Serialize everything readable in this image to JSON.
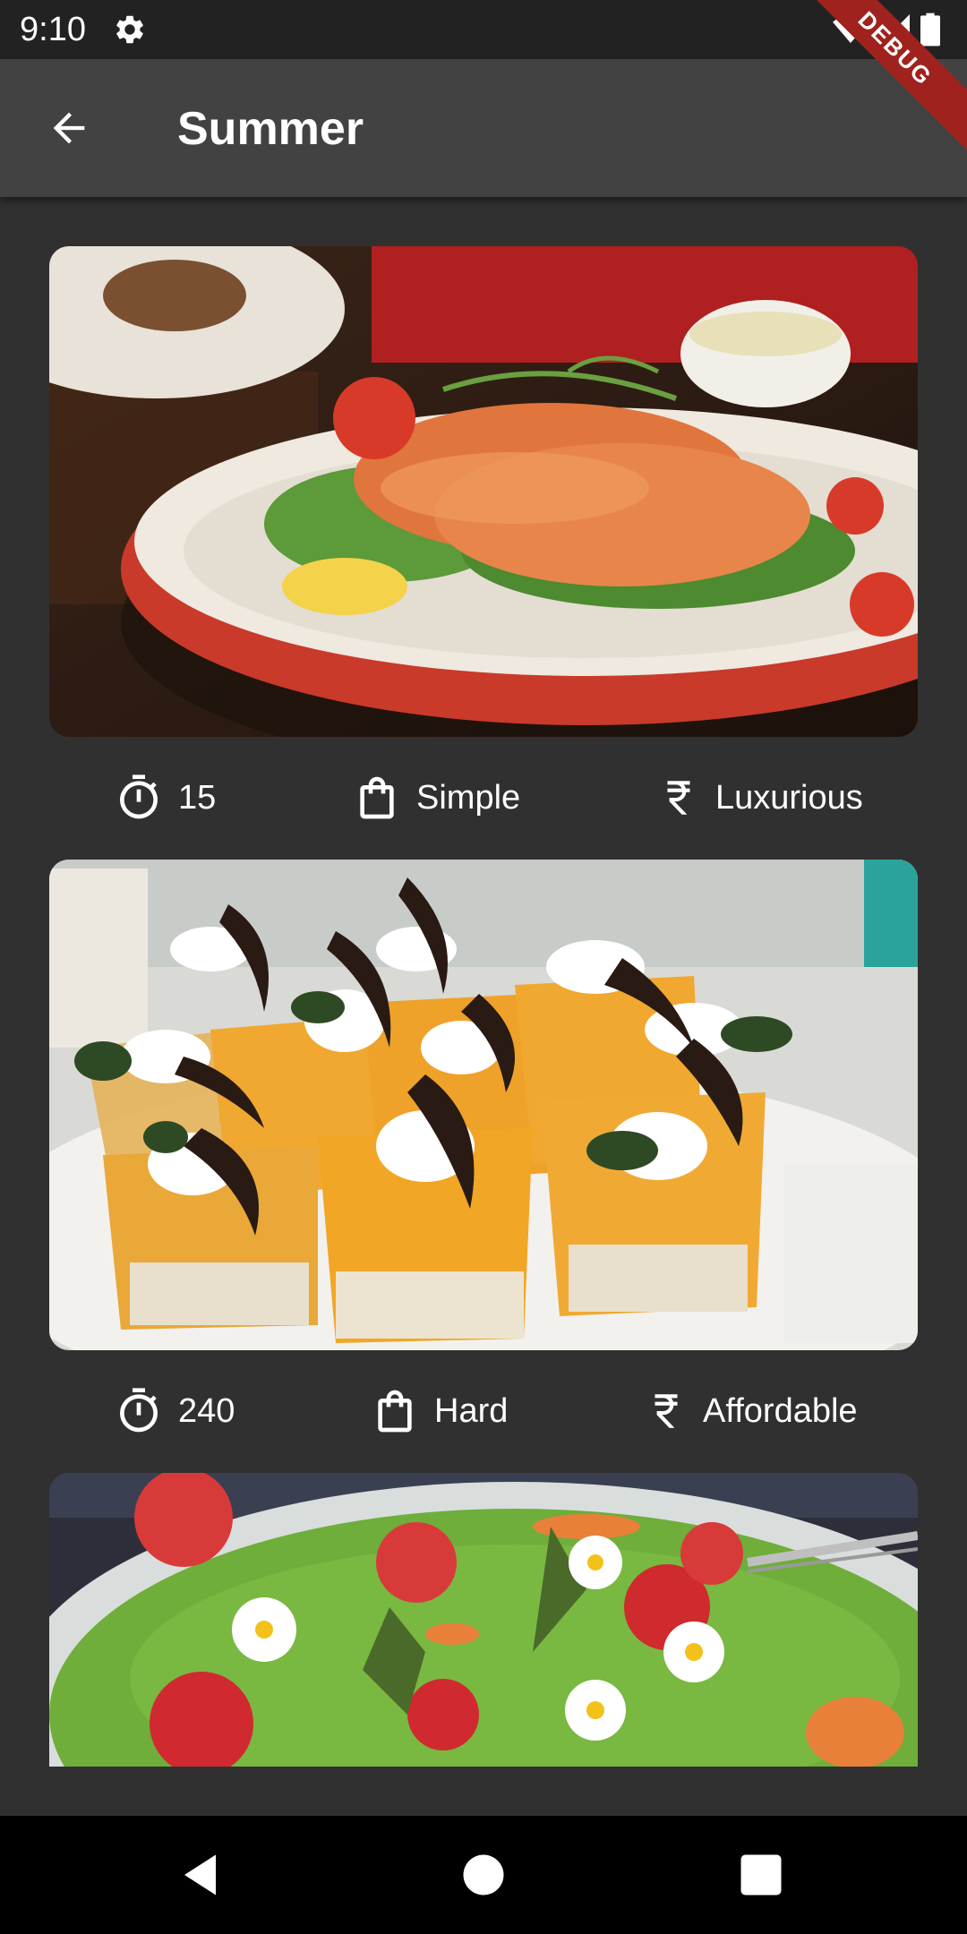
{
  "status_bar": {
    "time": "9:10",
    "icons": [
      "gear-icon",
      "wifi-icon",
      "signal-icon",
      "battery-icon"
    ]
  },
  "debug_banner": "DEBUG",
  "app_bar": {
    "back_icon": "arrow-back-icon",
    "title": "Summer"
  },
  "meals": [
    {
      "image": "smoked salmon salad plate",
      "duration": "15",
      "complexity": "Simple",
      "affordability": "Luxurious"
    },
    {
      "image": "mango mousse dessert cups",
      "duration": "240",
      "complexity": "Hard",
      "affordability": "Affordable"
    },
    {
      "image": "asparagus strawberry salad bowl",
      "duration": "",
      "complexity": "",
      "affordability": ""
    }
  ],
  "meta_icons": {
    "duration": "timer-icon",
    "complexity": "shopping-bag-icon",
    "affordability": "rupee-icon"
  },
  "navigation": [
    "back-nav-icon",
    "home-nav-icon",
    "recents-nav-icon"
  ],
  "colors": {
    "background": "#303030",
    "app_bar": "#424242",
    "status_bar": "#222222",
    "debug_banner": "#a0221e"
  }
}
